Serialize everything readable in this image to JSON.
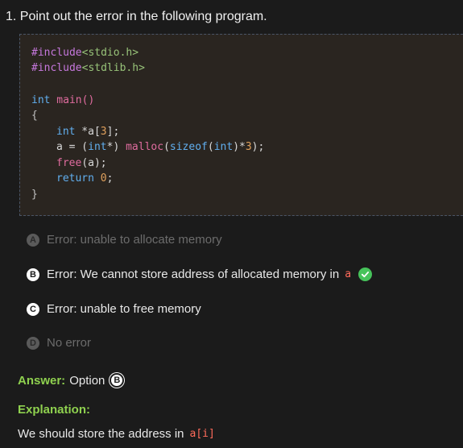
{
  "question": {
    "text": "1. Point out the error in the following program."
  },
  "code": {
    "line1_directive": "#include",
    "line1_header": "<stdio.h>",
    "line2_directive": "#include",
    "line2_header": "<stdlib.h>",
    "line3_type": "int",
    "line3_name": " main()",
    "line4_brace": "{",
    "line5_type": "int",
    "line5_rest": " *a[",
    "line5_num": "3",
    "line5_end": "];",
    "line6_a": "a = (",
    "line6_type": "int",
    "line6_b": "*) ",
    "line6_fn": "malloc",
    "line6_c": "(",
    "line6_kw": "sizeof",
    "line6_d": "(",
    "line6_type2": "int",
    "line6_e": ")*",
    "line6_num": "3",
    "line6_f": ");",
    "line7_fn": "free",
    "line7_rest": "(a);",
    "line8_kw": "return",
    "line8_num": " 0",
    "line8_end": ";",
    "line9_brace": "}"
  },
  "options": [
    {
      "letter": "A",
      "text": "Error: unable to allocate memory"
    },
    {
      "letter": "B",
      "text": "Error: We cannot store address of allocated memory in",
      "code": "a"
    },
    {
      "letter": "C",
      "text": "Error: unable to free memory"
    },
    {
      "letter": "D",
      "text": "No error"
    }
  ],
  "answer": {
    "label": "Answer:",
    "text": "Option",
    "letter": "B"
  },
  "explanation": {
    "title": "Explanation:",
    "text": "We should store the address in",
    "code": "a[i]"
  },
  "icons": {
    "correct": "check-circle-icon"
  },
  "colors": {
    "accent_green": "#8fd14f",
    "check_green": "#46c35a",
    "code_highlight": "#ff6b5b"
  }
}
